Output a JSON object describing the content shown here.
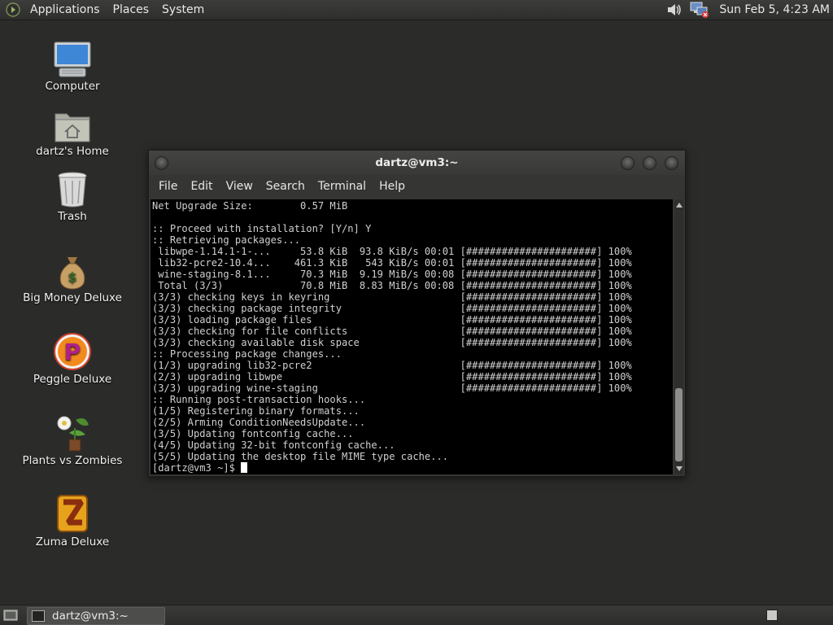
{
  "top_panel": {
    "menus": [
      "Applications",
      "Places",
      "System"
    ],
    "clock": "Sun Feb  5,  4:23 AM"
  },
  "desktop_icons": [
    {
      "label": "Computer",
      "icon": "computer-icon"
    },
    {
      "label": "dartz's Home",
      "icon": "home-folder-icon"
    },
    {
      "label": "Trash",
      "icon": "trash-icon"
    },
    {
      "label": "Big Money Deluxe",
      "icon": "money-bag-icon"
    },
    {
      "label": "Peggle Deluxe",
      "icon": "peggle-icon"
    },
    {
      "label": "Plants vs Zombies",
      "icon": "plants-icon"
    },
    {
      "label": "Zuma Deluxe",
      "icon": "zuma-icon"
    }
  ],
  "window": {
    "title": "dartz@vm3:~",
    "menus": [
      "File",
      "Edit",
      "View",
      "Search",
      "Terminal",
      "Help"
    ],
    "terminal_lines": [
      "Net Upgrade Size:        0.57 MiB",
      "",
      ":: Proceed with installation? [Y/n] Y",
      ":: Retrieving packages...",
      " libwpe-1.14.1-1-...     53.8 KiB  93.8 KiB/s 00:01 [######################] 100%",
      " lib32-pcre2-10.4...    461.3 KiB   543 KiB/s 00:01 [######################] 100%",
      " wine-staging-8.1...     70.3 MiB  9.19 MiB/s 00:08 [######################] 100%",
      " Total (3/3)             70.8 MiB  8.83 MiB/s 00:08 [######################] 100%",
      "(3/3) checking keys in keyring                      [######################] 100%",
      "(3/3) checking package integrity                    [######################] 100%",
      "(3/3) loading package files                         [######################] 100%",
      "(3/3) checking for file conflicts                   [######################] 100%",
      "(3/3) checking available disk space                 [######################] 100%",
      ":: Processing package changes...",
      "(1/3) upgrading lib32-pcre2                         [######################] 100%",
      "(2/3) upgrading libwpe                              [######################] 100%",
      "(3/3) upgrading wine-staging                        [######################] 100%",
      ":: Running post-transaction hooks...",
      "(1/5) Registering binary formats...",
      "(2/5) Arming ConditionNeedsUpdate...",
      "(3/5) Updating fontconfig cache...",
      "(4/5) Updating 32-bit fontconfig cache...",
      "(5/5) Updating the desktop file MIME type cache..."
    ],
    "prompt": "[dartz@vm3 ~]$ "
  },
  "bottom_panel": {
    "task_label": "dartz@vm3:~"
  }
}
